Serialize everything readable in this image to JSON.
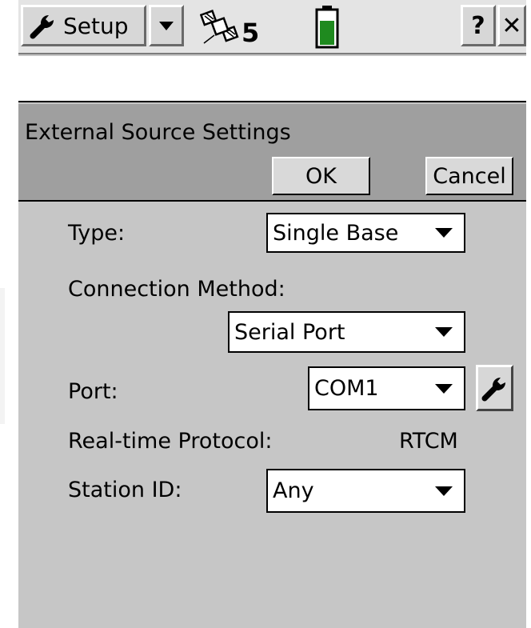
{
  "topbar": {
    "menu_label": "Setup",
    "satellite_count": "5",
    "help_label": "?",
    "close_label": "✕",
    "battery_level": 0.7
  },
  "dialog": {
    "title": "External Source Settings",
    "ok_label": "OK",
    "cancel_label": "Cancel"
  },
  "form": {
    "type": {
      "label": "Type:",
      "value": "Single Base"
    },
    "connection_method": {
      "label": "Connection Method:",
      "value": "Serial Port"
    },
    "port": {
      "label": "Port:",
      "value": "COM1"
    },
    "realtime_protocol": {
      "label": "Real-time Protocol:",
      "value": "RTCM"
    },
    "station_id": {
      "label": "Station ID:",
      "value": "Any"
    }
  },
  "colors": {
    "screen_bg": "#c6c6c6",
    "title_bg": "#9f9f9f",
    "battery_fill": "#1f8a1f"
  }
}
